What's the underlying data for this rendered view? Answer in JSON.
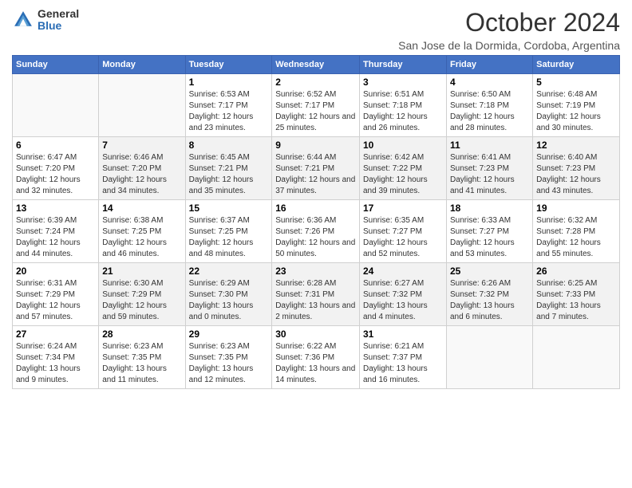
{
  "logo": {
    "general": "General",
    "blue": "Blue"
  },
  "title": "October 2024",
  "location": "San Jose de la Dormida, Cordoba, Argentina",
  "weekdays": [
    "Sunday",
    "Monday",
    "Tuesday",
    "Wednesday",
    "Thursday",
    "Friday",
    "Saturday"
  ],
  "weeks": [
    [
      {
        "day": "",
        "sunrise": "",
        "sunset": "",
        "daylight": ""
      },
      {
        "day": "",
        "sunrise": "",
        "sunset": "",
        "daylight": ""
      },
      {
        "day": "1",
        "sunrise": "Sunrise: 6:53 AM",
        "sunset": "Sunset: 7:17 PM",
        "daylight": "Daylight: 12 hours and 23 minutes."
      },
      {
        "day": "2",
        "sunrise": "Sunrise: 6:52 AM",
        "sunset": "Sunset: 7:17 PM",
        "daylight": "Daylight: 12 hours and 25 minutes."
      },
      {
        "day": "3",
        "sunrise": "Sunrise: 6:51 AM",
        "sunset": "Sunset: 7:18 PM",
        "daylight": "Daylight: 12 hours and 26 minutes."
      },
      {
        "day": "4",
        "sunrise": "Sunrise: 6:50 AM",
        "sunset": "Sunset: 7:18 PM",
        "daylight": "Daylight: 12 hours and 28 minutes."
      },
      {
        "day": "5",
        "sunrise": "Sunrise: 6:48 AM",
        "sunset": "Sunset: 7:19 PM",
        "daylight": "Daylight: 12 hours and 30 minutes."
      }
    ],
    [
      {
        "day": "6",
        "sunrise": "Sunrise: 6:47 AM",
        "sunset": "Sunset: 7:20 PM",
        "daylight": "Daylight: 12 hours and 32 minutes."
      },
      {
        "day": "7",
        "sunrise": "Sunrise: 6:46 AM",
        "sunset": "Sunset: 7:20 PM",
        "daylight": "Daylight: 12 hours and 34 minutes."
      },
      {
        "day": "8",
        "sunrise": "Sunrise: 6:45 AM",
        "sunset": "Sunset: 7:21 PM",
        "daylight": "Daylight: 12 hours and 35 minutes."
      },
      {
        "day": "9",
        "sunrise": "Sunrise: 6:44 AM",
        "sunset": "Sunset: 7:21 PM",
        "daylight": "Daylight: 12 hours and 37 minutes."
      },
      {
        "day": "10",
        "sunrise": "Sunrise: 6:42 AM",
        "sunset": "Sunset: 7:22 PM",
        "daylight": "Daylight: 12 hours and 39 minutes."
      },
      {
        "day": "11",
        "sunrise": "Sunrise: 6:41 AM",
        "sunset": "Sunset: 7:23 PM",
        "daylight": "Daylight: 12 hours and 41 minutes."
      },
      {
        "day": "12",
        "sunrise": "Sunrise: 6:40 AM",
        "sunset": "Sunset: 7:23 PM",
        "daylight": "Daylight: 12 hours and 43 minutes."
      }
    ],
    [
      {
        "day": "13",
        "sunrise": "Sunrise: 6:39 AM",
        "sunset": "Sunset: 7:24 PM",
        "daylight": "Daylight: 12 hours and 44 minutes."
      },
      {
        "day": "14",
        "sunrise": "Sunrise: 6:38 AM",
        "sunset": "Sunset: 7:25 PM",
        "daylight": "Daylight: 12 hours and 46 minutes."
      },
      {
        "day": "15",
        "sunrise": "Sunrise: 6:37 AM",
        "sunset": "Sunset: 7:25 PM",
        "daylight": "Daylight: 12 hours and 48 minutes."
      },
      {
        "day": "16",
        "sunrise": "Sunrise: 6:36 AM",
        "sunset": "Sunset: 7:26 PM",
        "daylight": "Daylight: 12 hours and 50 minutes."
      },
      {
        "day": "17",
        "sunrise": "Sunrise: 6:35 AM",
        "sunset": "Sunset: 7:27 PM",
        "daylight": "Daylight: 12 hours and 52 minutes."
      },
      {
        "day": "18",
        "sunrise": "Sunrise: 6:33 AM",
        "sunset": "Sunset: 7:27 PM",
        "daylight": "Daylight: 12 hours and 53 minutes."
      },
      {
        "day": "19",
        "sunrise": "Sunrise: 6:32 AM",
        "sunset": "Sunset: 7:28 PM",
        "daylight": "Daylight: 12 hours and 55 minutes."
      }
    ],
    [
      {
        "day": "20",
        "sunrise": "Sunrise: 6:31 AM",
        "sunset": "Sunset: 7:29 PM",
        "daylight": "Daylight: 12 hours and 57 minutes."
      },
      {
        "day": "21",
        "sunrise": "Sunrise: 6:30 AM",
        "sunset": "Sunset: 7:29 PM",
        "daylight": "Daylight: 12 hours and 59 minutes."
      },
      {
        "day": "22",
        "sunrise": "Sunrise: 6:29 AM",
        "sunset": "Sunset: 7:30 PM",
        "daylight": "Daylight: 13 hours and 0 minutes."
      },
      {
        "day": "23",
        "sunrise": "Sunrise: 6:28 AM",
        "sunset": "Sunset: 7:31 PM",
        "daylight": "Daylight: 13 hours and 2 minutes."
      },
      {
        "day": "24",
        "sunrise": "Sunrise: 6:27 AM",
        "sunset": "Sunset: 7:32 PM",
        "daylight": "Daylight: 13 hours and 4 minutes."
      },
      {
        "day": "25",
        "sunrise": "Sunrise: 6:26 AM",
        "sunset": "Sunset: 7:32 PM",
        "daylight": "Daylight: 13 hours and 6 minutes."
      },
      {
        "day": "26",
        "sunrise": "Sunrise: 6:25 AM",
        "sunset": "Sunset: 7:33 PM",
        "daylight": "Daylight: 13 hours and 7 minutes."
      }
    ],
    [
      {
        "day": "27",
        "sunrise": "Sunrise: 6:24 AM",
        "sunset": "Sunset: 7:34 PM",
        "daylight": "Daylight: 13 hours and 9 minutes."
      },
      {
        "day": "28",
        "sunrise": "Sunrise: 6:23 AM",
        "sunset": "Sunset: 7:35 PM",
        "daylight": "Daylight: 13 hours and 11 minutes."
      },
      {
        "day": "29",
        "sunrise": "Sunrise: 6:23 AM",
        "sunset": "Sunset: 7:35 PM",
        "daylight": "Daylight: 13 hours and 12 minutes."
      },
      {
        "day": "30",
        "sunrise": "Sunrise: 6:22 AM",
        "sunset": "Sunset: 7:36 PM",
        "daylight": "Daylight: 13 hours and 14 minutes."
      },
      {
        "day": "31",
        "sunrise": "Sunrise: 6:21 AM",
        "sunset": "Sunset: 7:37 PM",
        "daylight": "Daylight: 13 hours and 16 minutes."
      },
      {
        "day": "",
        "sunrise": "",
        "sunset": "",
        "daylight": ""
      },
      {
        "day": "",
        "sunrise": "",
        "sunset": "",
        "daylight": ""
      }
    ]
  ]
}
